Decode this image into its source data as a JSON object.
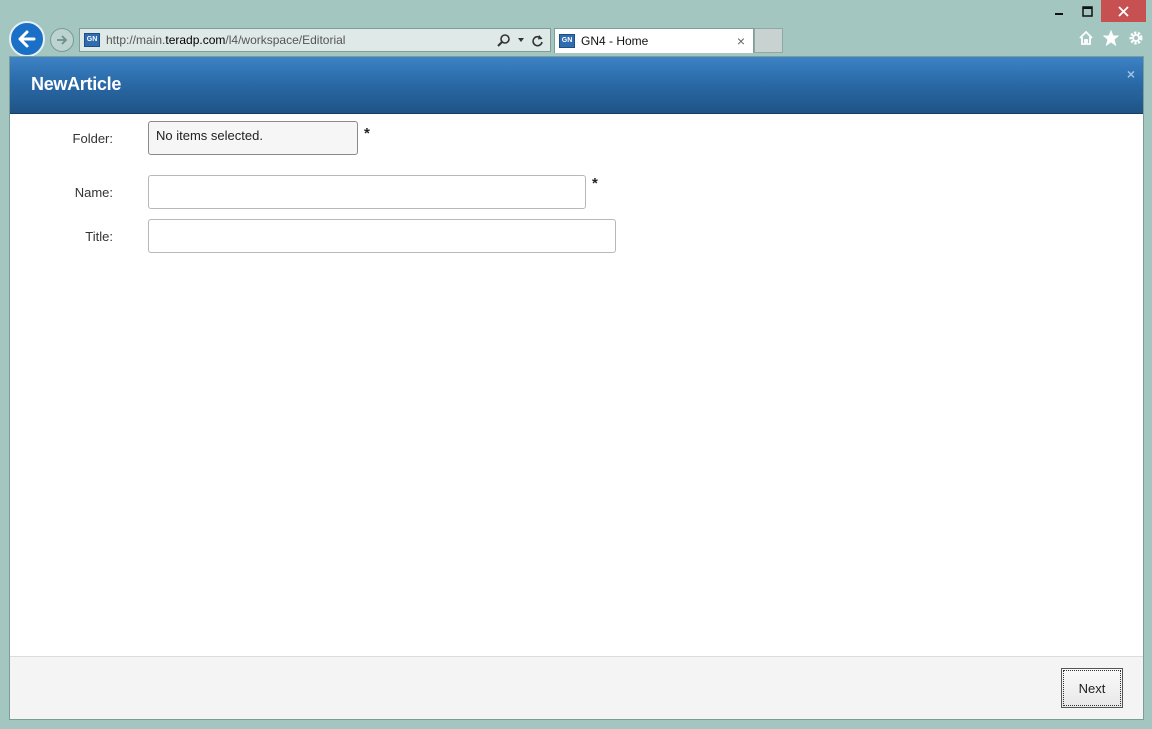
{
  "browser": {
    "url_prefix": "http://main.",
    "url_domain": "teradp.com",
    "url_path": "/l4/workspace/Editorial",
    "favicon_text": "GN",
    "tab_title": "GN4 - Home",
    "tab_close": "×",
    "icons": [
      "back-icon",
      "forward-icon",
      "search-icon",
      "refresh-icon",
      "home-icon",
      "star-icon",
      "gear-icon",
      "minimize-icon",
      "maximize-icon",
      "close-icon"
    ]
  },
  "dialog": {
    "title": "NewArticle",
    "close_label": "×",
    "header_color": "#2a6aa8",
    "fields": {
      "folder": {
        "label": "Folder:",
        "value": "No items selected.",
        "required_mark": "*"
      },
      "name": {
        "label": "Name:",
        "value": "",
        "required_mark": "*"
      },
      "title": {
        "label": "Title:",
        "value": ""
      }
    },
    "footer": {
      "next_label": "Next"
    }
  }
}
